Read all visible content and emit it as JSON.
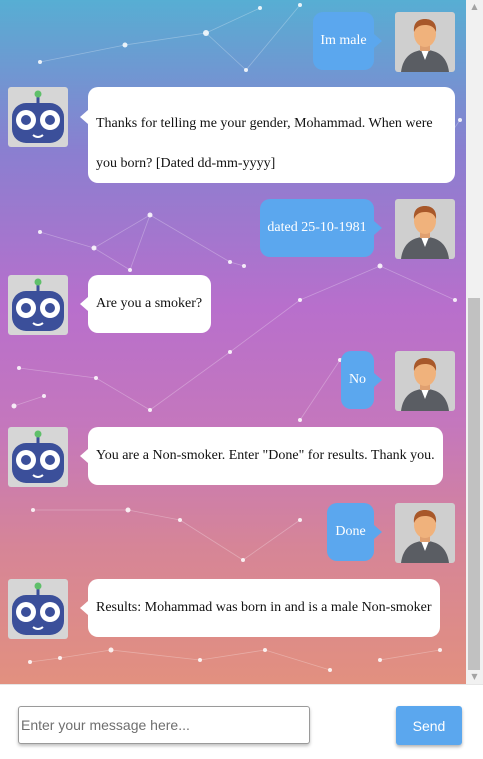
{
  "messages": [
    {
      "from": "user",
      "text": "Im male"
    },
    {
      "from": "bot",
      "text": "Thanks for telling me your gender, Mohammad. When were you born? [Dated dd-mm-yyyy]"
    },
    {
      "from": "user",
      "text": "dated 25-10-1981"
    },
    {
      "from": "bot",
      "text": "Are you a smoker?"
    },
    {
      "from": "user",
      "text": "No"
    },
    {
      "from": "bot",
      "text": "You are a Non-smoker. Enter \"Done\" for results. Thank you."
    },
    {
      "from": "user",
      "text": "Done"
    },
    {
      "from": "bot",
      "text": "Results: Mohammad was born in and is a male Non-smoker"
    }
  ],
  "avatars": {
    "user": "user-avatar-icon",
    "bot": "robot-avatar-icon"
  },
  "composer": {
    "placeholder": "Enter your message here...",
    "send_label": "Send"
  },
  "colors": {
    "accent": "#5ba7ee",
    "bot_bubble": "#ffffff"
  }
}
